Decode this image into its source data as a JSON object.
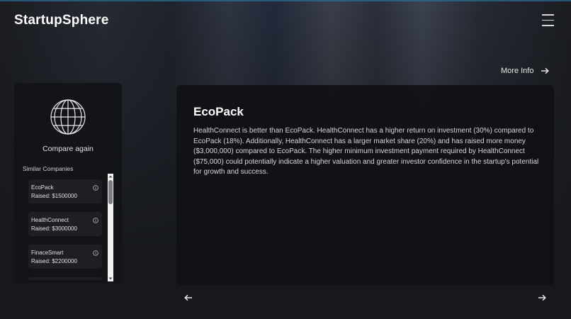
{
  "header": {
    "logo": "StartupSphere",
    "menu_icon": "hamburger-menu-icon"
  },
  "more_info": {
    "label": "More Info",
    "icon": "arrow-right-icon"
  },
  "sidebar": {
    "globe_icon": "globe-icon",
    "compare_again_label": "Compare again",
    "similar_title": "Similar Companies",
    "companies": [
      {
        "name": "EcoPack",
        "raised": "Raised: $1500000"
      },
      {
        "name": "HealthConnect",
        "raised": "Raised: $3000000"
      },
      {
        "name": "FinaceSmart",
        "raised": "Raised: $2200000"
      }
    ]
  },
  "main": {
    "title": "EcoPack",
    "body": "HealthConnect is better than EcoPack. HealthConnect has a higher return on investment (30%) compared to EcoPack (18%). Additionally, HealthConnect has a larger market share (20%) and has raised more money ($3,000,000) compared to EcoPack. The higher minimum investment payment required by HealthConnect ($75,000) could potentially indicate a higher valuation and greater investor confidence in the startup's potential for growth and success."
  },
  "nav": {
    "prev_icon": "arrow-left-icon",
    "next_icon": "arrow-right-icon"
  }
}
